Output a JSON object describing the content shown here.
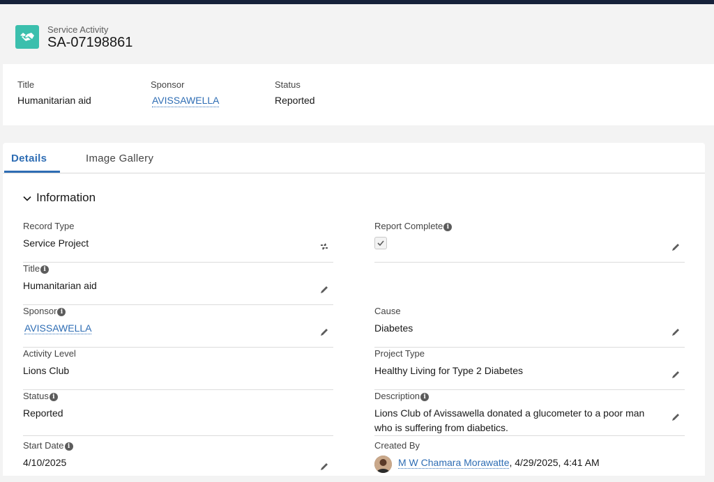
{
  "header": {
    "object_label": "Service Activity",
    "record_name": "SA-07198861",
    "icon": "handshake-icon"
  },
  "highlights": {
    "title_label": "Title",
    "title_value": "Humanitarian aid",
    "sponsor_label": "Sponsor",
    "sponsor_value": "AVISSAWELLA",
    "status_label": "Status",
    "status_value": "Reported"
  },
  "tabs": [
    {
      "label": "Details",
      "active": true
    },
    {
      "label": "Image Gallery",
      "active": false
    }
  ],
  "section": {
    "title": "Information"
  },
  "fields": {
    "record_type": {
      "label": "Record Type",
      "value": "Service Project"
    },
    "report_complete": {
      "label": "Report Complete",
      "checked": true
    },
    "title": {
      "label": "Title",
      "value": "Humanitarian aid"
    },
    "sponsor": {
      "label": "Sponsor",
      "value": "AVISSAWELLA"
    },
    "cause": {
      "label": "Cause",
      "value": "Diabetes"
    },
    "activity_level": {
      "label": "Activity Level",
      "value": "Lions Club"
    },
    "project_type": {
      "label": "Project Type",
      "value": "Healthy Living for Type 2 Diabetes"
    },
    "status": {
      "label": "Status",
      "value": "Reported"
    },
    "description": {
      "label": "Description",
      "value": "Lions Club of Avissawella donated a glucometer to a poor man who is suffering from diabetics."
    },
    "start_date": {
      "label": "Start Date",
      "value": "4/10/2025"
    },
    "created_by": {
      "label": "Created By",
      "user": "M W Chamara Morawatte",
      "datetime": ", 4/29/2025, 4:41 AM"
    }
  },
  "colors": {
    "brand_icon": "#3bbfad",
    "link": "#2e6db4",
    "top_bar": "#16213a"
  }
}
